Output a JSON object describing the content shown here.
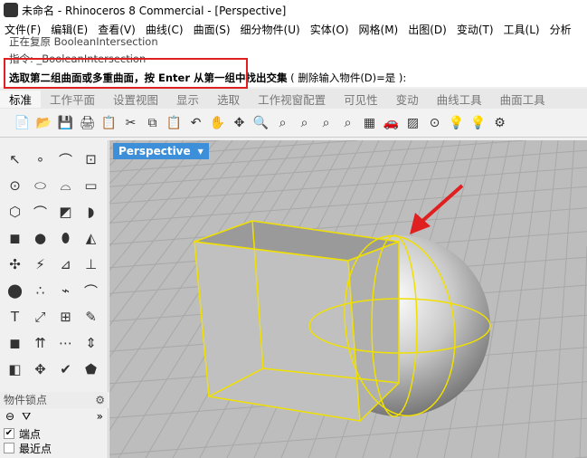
{
  "window": {
    "title": "未命名 - Rhinoceros 8 Commercial - [Perspective]",
    "logo": "R"
  },
  "menu": [
    "文件(F)",
    "编辑(E)",
    "查看(V)",
    "曲线(C)",
    "曲面(S)",
    "细分物件(U)",
    "实体(O)",
    "网格(M)",
    "出图(D)",
    "变动(T)",
    "工具(L)",
    "分析"
  ],
  "command": {
    "history1": "正在复原 BooleanIntersection",
    "history2": "指令: _BooleanIntersection",
    "prompt": "选取第二组曲面或多重曲面，按 Enter 从第一组中找出交集",
    "option": "( 删除输入物件(D)=是 ):"
  },
  "tabs": [
    "标准",
    "工作平面",
    "设置视图",
    "显示",
    "选取",
    "工作视窗配置",
    "可见性",
    "变动",
    "曲线工具",
    "曲面工具"
  ],
  "toolbar": [
    "📄",
    "📂",
    "💾",
    "🖨",
    "📋",
    "✂",
    "⧉",
    "📋",
    "↶",
    "✋",
    "✥",
    "🔍",
    "⌕",
    "⌕",
    "⌕",
    "⌕",
    "▦",
    "🚗",
    "▨",
    "⊙",
    "💡",
    "💡",
    "⚙"
  ],
  "left_tools": [
    "↖",
    "∘",
    "⌒",
    "⊡",
    "⊙",
    "⬭",
    "⌓",
    "▭",
    "⬡",
    "⌒",
    "◩",
    "◗",
    "◼",
    "●",
    "⬮",
    "◭",
    "✣",
    "⚡",
    "⊿",
    "⊥",
    "⬤",
    "∴",
    "⌁",
    "⌒",
    "T",
    "⤢",
    "⊞",
    "✎",
    "◼",
    "⇈",
    "⋯",
    "⇕",
    "◧",
    "✥",
    "✔",
    "⬟"
  ],
  "osnap": {
    "title": "物件锁点",
    "more": "»",
    "items": [
      {
        "label": "端点",
        "checked": true
      },
      {
        "label": "最近点",
        "checked": false
      }
    ]
  },
  "viewport": {
    "name": "Perspective"
  },
  "colors": {
    "accent": "#3c8fd8",
    "highlight": "#e02020",
    "selection": "#f0e000"
  }
}
